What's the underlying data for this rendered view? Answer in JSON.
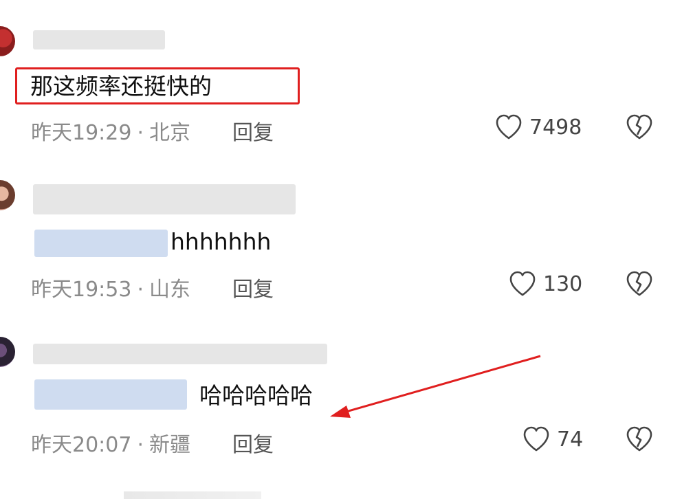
{
  "comments": [
    {
      "body_suffix": "那这频率还挺快的",
      "time": "昨天19:29",
      "location": "北京",
      "reply_label": "回复",
      "likes": "7498"
    },
    {
      "body_suffix": "hhhhhhh",
      "time": "昨天19:53",
      "location": "山东",
      "reply_label": "回复",
      "likes": "130"
    },
    {
      "body_suffix": "哈哈哈哈哈",
      "time": "昨天20:07",
      "location": "新疆",
      "reply_label": "回复",
      "likes": "74"
    }
  ],
  "meta_separator": "·",
  "icons": {
    "like": "heart-outline-icon",
    "dislike": "broken-heart-icon"
  },
  "colors": {
    "annotation_red": "#e01f1f",
    "meta_gray": "#8a8a8a",
    "mention_blur": "#cfdcf0"
  }
}
